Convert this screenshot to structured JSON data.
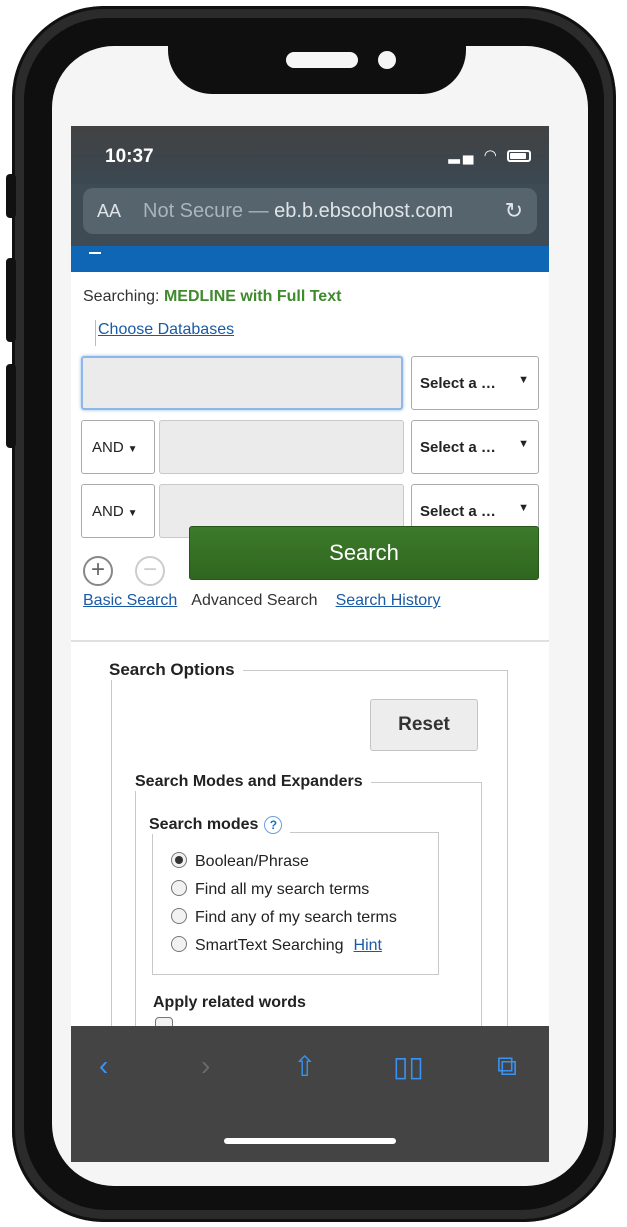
{
  "status_bar": {
    "time": "10:37",
    "signal_icon": "signal-icon",
    "wifi_icon": "wifi-icon",
    "battery_icon": "battery-icon"
  },
  "address_bar": {
    "text_size_label": "AA",
    "security_label": "Not Secure —",
    "domain": "eb.b.ebscohost.com",
    "reload_icon": "reload-icon"
  },
  "search": {
    "searching_prefix": "Searching:",
    "database_name": "MEDLINE with Full Text",
    "choose_databases_link": "Choose Databases",
    "rows": [
      {
        "operator": "",
        "value": "",
        "field_select": "Select a …"
      },
      {
        "operator": "AND",
        "value": "",
        "field_select": "Select a …"
      },
      {
        "operator": "AND",
        "value": "",
        "field_select": "Select a …"
      }
    ],
    "add_row_icon": "plus-circle-icon",
    "remove_row_icon": "minus-circle-icon",
    "search_button": "Search",
    "tabs": {
      "basic": "Basic Search",
      "advanced": "Advanced Search",
      "history": "Search History"
    }
  },
  "options": {
    "title": "Search Options",
    "reset_button": "Reset",
    "modes_expanders_title": "Search Modes and Expanders",
    "search_modes_title": "Search modes",
    "help_icon": "help-icon",
    "modes": [
      {
        "label": "Boolean/Phrase",
        "checked": true
      },
      {
        "label": "Find all my search terms",
        "checked": false
      },
      {
        "label": "Find any of my search terms",
        "checked": false
      },
      {
        "label": "SmartText Searching",
        "checked": false
      }
    ],
    "hint_link": "Hint",
    "apply_related_words": "Apply related words"
  },
  "toolbar": {
    "back": "back-icon",
    "forward": "forward-icon",
    "share": "share-icon",
    "bookmarks": "bookmarks-icon",
    "tabs": "tabs-icon"
  },
  "colors": {
    "accent_blue": "#0e66b5",
    "search_green": "#3d7a2a",
    "database_green": "#3f8a2c",
    "link_blue": "#1a5aa5",
    "toolbar_icon": "#3a93f2"
  }
}
